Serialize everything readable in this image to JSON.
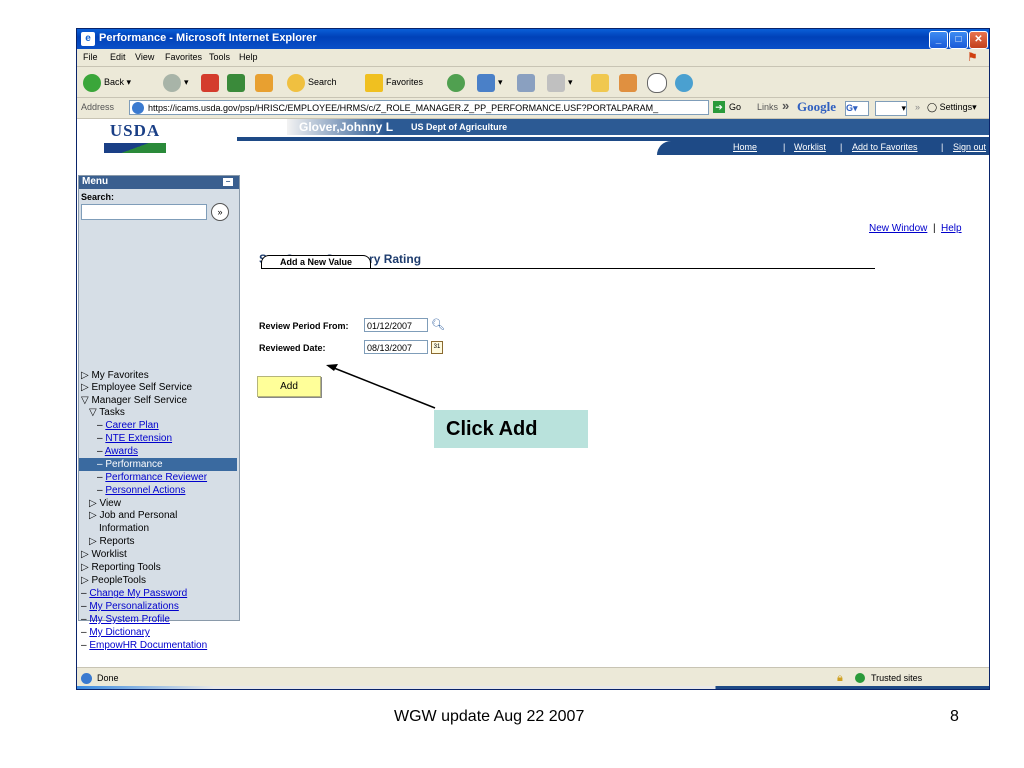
{
  "window": {
    "title": "Performance - Microsoft Internet Explorer",
    "menu": [
      "File",
      "Edit",
      "View",
      "Favorites",
      "Tools",
      "Help"
    ],
    "toolbar": {
      "back": "Back",
      "search": "Search",
      "favorites": "Favorites"
    },
    "address_label": "Address",
    "address_url": "https://icams.usda.gov/psp/HRISC/EMPLOYEE/HRMS/c/Z_ROLE_MANAGER.Z_PP_PERFORMANCE.USF?PORTALPARAM_",
    "go_label": "Go",
    "links_label": "Links",
    "google_label": "Google",
    "settings_label": "Settings",
    "status_text": "Done",
    "zone_text": "Trusted sites"
  },
  "header": {
    "logo": "USDA",
    "user_name": "Glover,Johnny L",
    "agency": "US Dept of Agriculture",
    "nav": [
      "Home",
      "Worklist",
      "Add to Favorites",
      "Sign out"
    ]
  },
  "sidebar": {
    "title": "Menu",
    "search_label": "Search:",
    "items": [
      {
        "label": "My Favorites",
        "prefix": "▷"
      },
      {
        "label": "Employee Self Service",
        "prefix": "▷"
      },
      {
        "label": "Manager Self Service",
        "prefix": "▽"
      },
      {
        "label": "Tasks",
        "prefix": "▽"
      },
      {
        "label": "Career Plan",
        "prefix": "–"
      },
      {
        "label": "NTE Extension",
        "prefix": "–"
      },
      {
        "label": "Awards",
        "prefix": "–"
      },
      {
        "label": "Performance",
        "prefix": "–"
      },
      {
        "label": "Performance Reviewer",
        "prefix": "–"
      },
      {
        "label": "Personnel Actions",
        "prefix": "–"
      },
      {
        "label": "View",
        "prefix": "▷"
      },
      {
        "label": "Job and Personal",
        "prefix": "▷"
      },
      {
        "label": "Information",
        "prefix": ""
      },
      {
        "label": "Reports",
        "prefix": "▷"
      },
      {
        "label": "Worklist",
        "prefix": "▷"
      },
      {
        "label": "Reporting Tools",
        "prefix": "▷"
      },
      {
        "label": "PeopleTools",
        "prefix": "▷"
      },
      {
        "label": "Change My Password",
        "prefix": "–"
      },
      {
        "label": "My Personalizations",
        "prefix": "–"
      },
      {
        "label": "My System Profile",
        "prefix": "–"
      },
      {
        "label": "My Dictionary",
        "prefix": "–"
      },
      {
        "label": "EmpowHR Documentation",
        "prefix": "–"
      }
    ]
  },
  "main": {
    "new_window": "New Window",
    "help": "Help",
    "page_title": "Sup Create Summary Rating",
    "tab_label": "Add a New Value",
    "review_period_label": "Review Period From:",
    "review_period_value": "01/12/2007",
    "reviewed_date_label": "Reviewed Date:",
    "reviewed_date_value": "08/13/2007",
    "add_button": "Add"
  },
  "slide": {
    "callout": "Click Add",
    "footer": "WGW update Aug 22 2007",
    "page_number": "8"
  }
}
